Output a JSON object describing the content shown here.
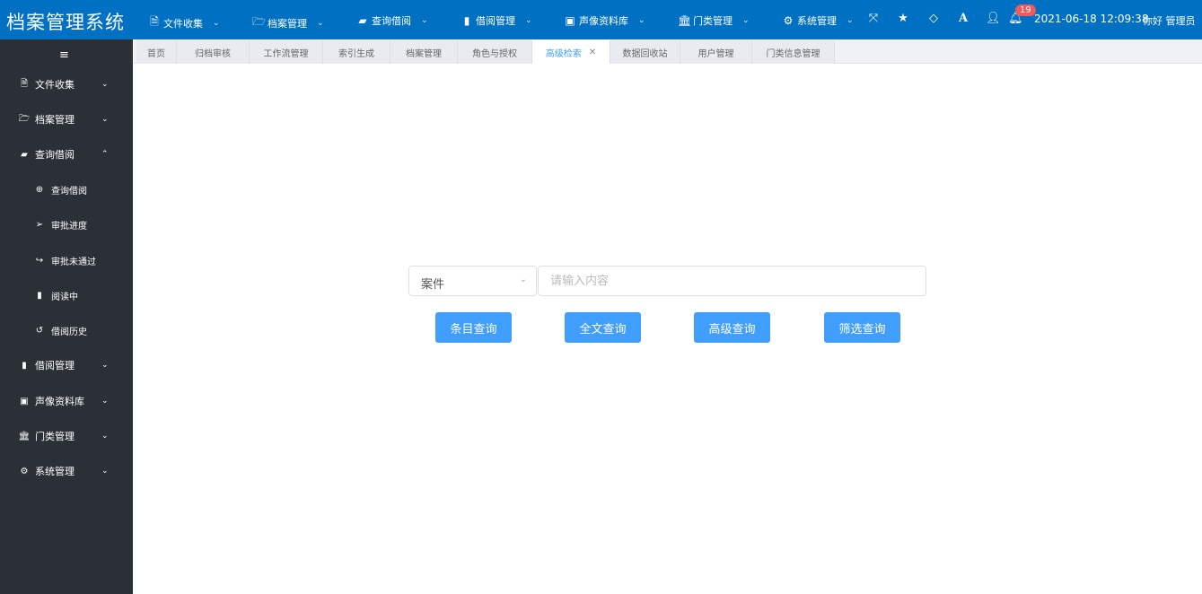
{
  "app_title": "档案管理系统",
  "top_nav": [
    {
      "label": "文件收集",
      "icon": "file-pdf-icon"
    },
    {
      "label": "档案管理",
      "icon": "folder-open-icon"
    },
    {
      "label": "查询借阅",
      "icon": "book-icon"
    },
    {
      "label": "借阅管理",
      "icon": "bookmark-icon"
    },
    {
      "label": "声像资料库",
      "icon": "media-file-icon"
    },
    {
      "label": "门类管理",
      "icon": "bank-icon"
    },
    {
      "label": "系统管理",
      "icon": "cogs-icon"
    }
  ],
  "header_tools": {
    "notification_count": "19",
    "datetime": "2021-06-18 12:09:38",
    "greeting": "你好 管理员"
  },
  "sidebar": [
    {
      "label": "文件收集",
      "icon": "file-pdf-icon",
      "chev": "⌄"
    },
    {
      "label": "档案管理",
      "icon": "folder-open-icon",
      "chev": "⌄"
    },
    {
      "label": "查询借阅",
      "icon": "book-icon",
      "chev": "⌃"
    },
    {
      "label": "查询借阅",
      "icon": "search-plus-icon",
      "sub": true
    },
    {
      "label": "审批进度",
      "icon": "paper-plane-icon",
      "sub": true
    },
    {
      "label": "审批未通过",
      "icon": "share-icon",
      "sub": true
    },
    {
      "label": "阅读中",
      "icon": "bookmark-icon",
      "sub": true
    },
    {
      "label": "借阅历史",
      "icon": "history-icon",
      "sub": true
    },
    {
      "label": "借阅管理",
      "icon": "bookmark-icon",
      "chev": "⌄"
    },
    {
      "label": "声像资料库",
      "icon": "media-file-icon",
      "chev": "⌄"
    },
    {
      "label": "门类管理",
      "icon": "bank-icon",
      "chev": "⌄"
    },
    {
      "label": "系统管理",
      "icon": "cogs-icon",
      "chev": "⌄"
    }
  ],
  "tabs": [
    "首页",
    "归档审核",
    "工作流管理",
    "索引生成",
    "档案管理",
    "角色与授权",
    "高级检索",
    "数据回收站",
    "用户管理",
    "门类信息管理"
  ],
  "active_tab": "高级检索",
  "search": {
    "type_value": "案件",
    "placeholder": "请输入内容",
    "value": ""
  },
  "buttons": [
    "条目查询",
    "全文查询",
    "高级查询",
    "筛选查询"
  ],
  "colors": {
    "header": "#0071c2",
    "sidebar": "#2b2f36",
    "primary": "#409eff",
    "badge": "#f05a5a"
  }
}
